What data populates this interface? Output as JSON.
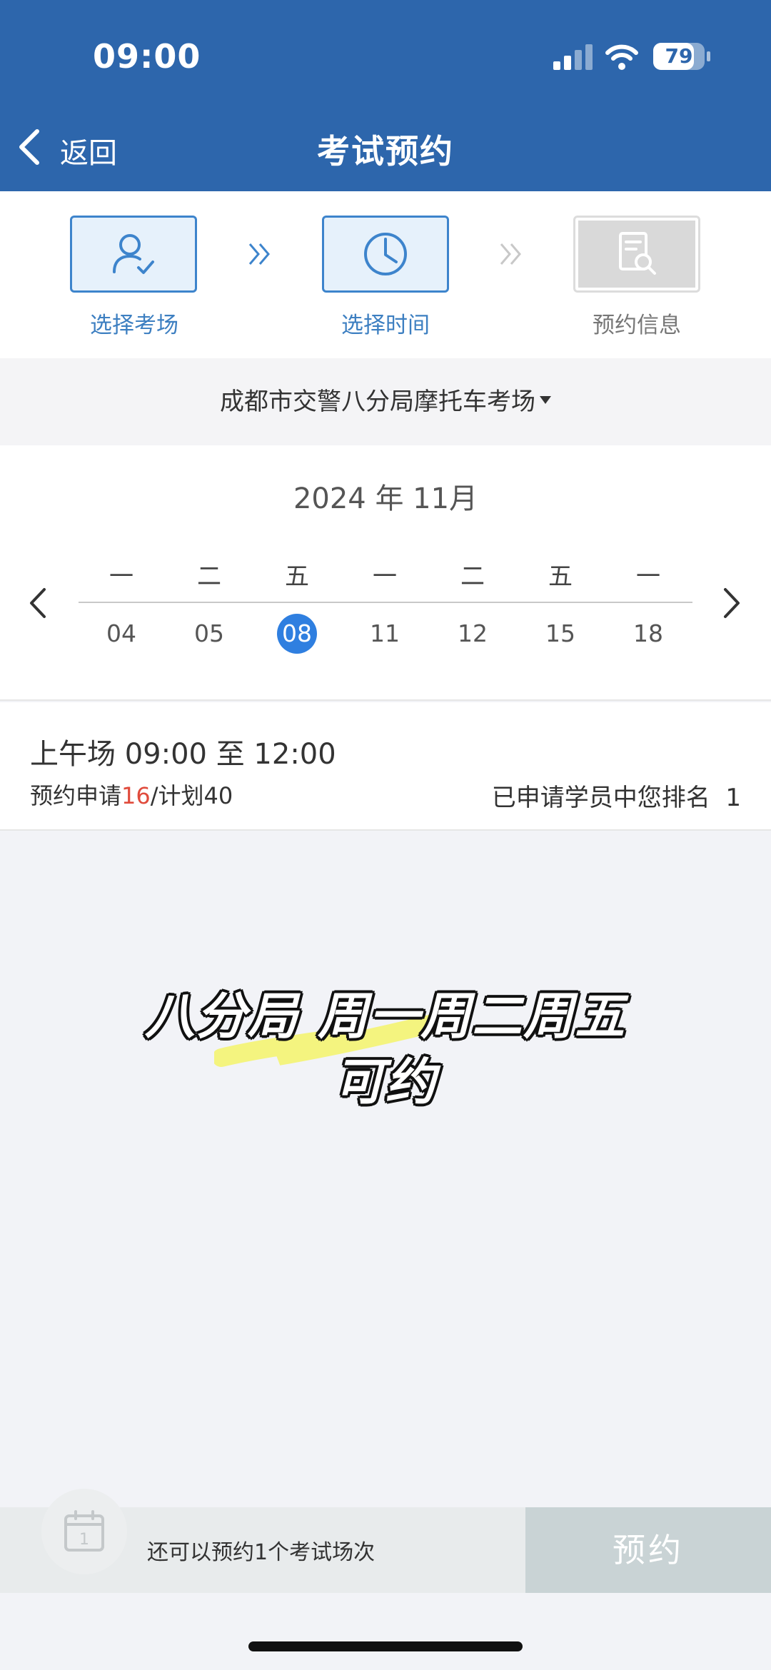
{
  "status_bar": {
    "time": "09:00",
    "battery": "79",
    "battery_level": 0.79
  },
  "nav": {
    "back_label": "返回",
    "title": "考试预约"
  },
  "steps": [
    {
      "label": "选择考场",
      "icon": "user-check-icon",
      "state": "active"
    },
    {
      "label": "选择时间",
      "icon": "clock-icon",
      "state": "active"
    },
    {
      "label": "预约信息",
      "icon": "document-search-icon",
      "state": "inactive"
    }
  ],
  "venue": {
    "name": "成都市交警八分局摩托车考场"
  },
  "calendar": {
    "month": "2024 年 11月",
    "days": [
      {
        "weekday": "一",
        "day": "04"
      },
      {
        "weekday": "二",
        "day": "05"
      },
      {
        "weekday": "五",
        "day": "08",
        "selected": true
      },
      {
        "weekday": "一",
        "day": "11"
      },
      {
        "weekday": "二",
        "day": "12"
      },
      {
        "weekday": "五",
        "day": "15"
      },
      {
        "weekday": "一",
        "day": "18"
      }
    ]
  },
  "session": {
    "title": "上午场 09:00 至 12:00",
    "apply_prefix": "预约申请",
    "applied": "16",
    "plan_text": "/计划40",
    "rank_label": "已申请学员中您排名",
    "rank_value": "1"
  },
  "overlay": {
    "line1": "八分局 周一周二周五",
    "line2": "可约"
  },
  "bottom": {
    "remaining": "还可以预约1个考试场次",
    "book_label": "预约"
  },
  "colors": {
    "header": "#2d66ac",
    "accent": "#3d84cc",
    "selected_day": "#2f7fe0",
    "applied": "#e04b3c"
  }
}
